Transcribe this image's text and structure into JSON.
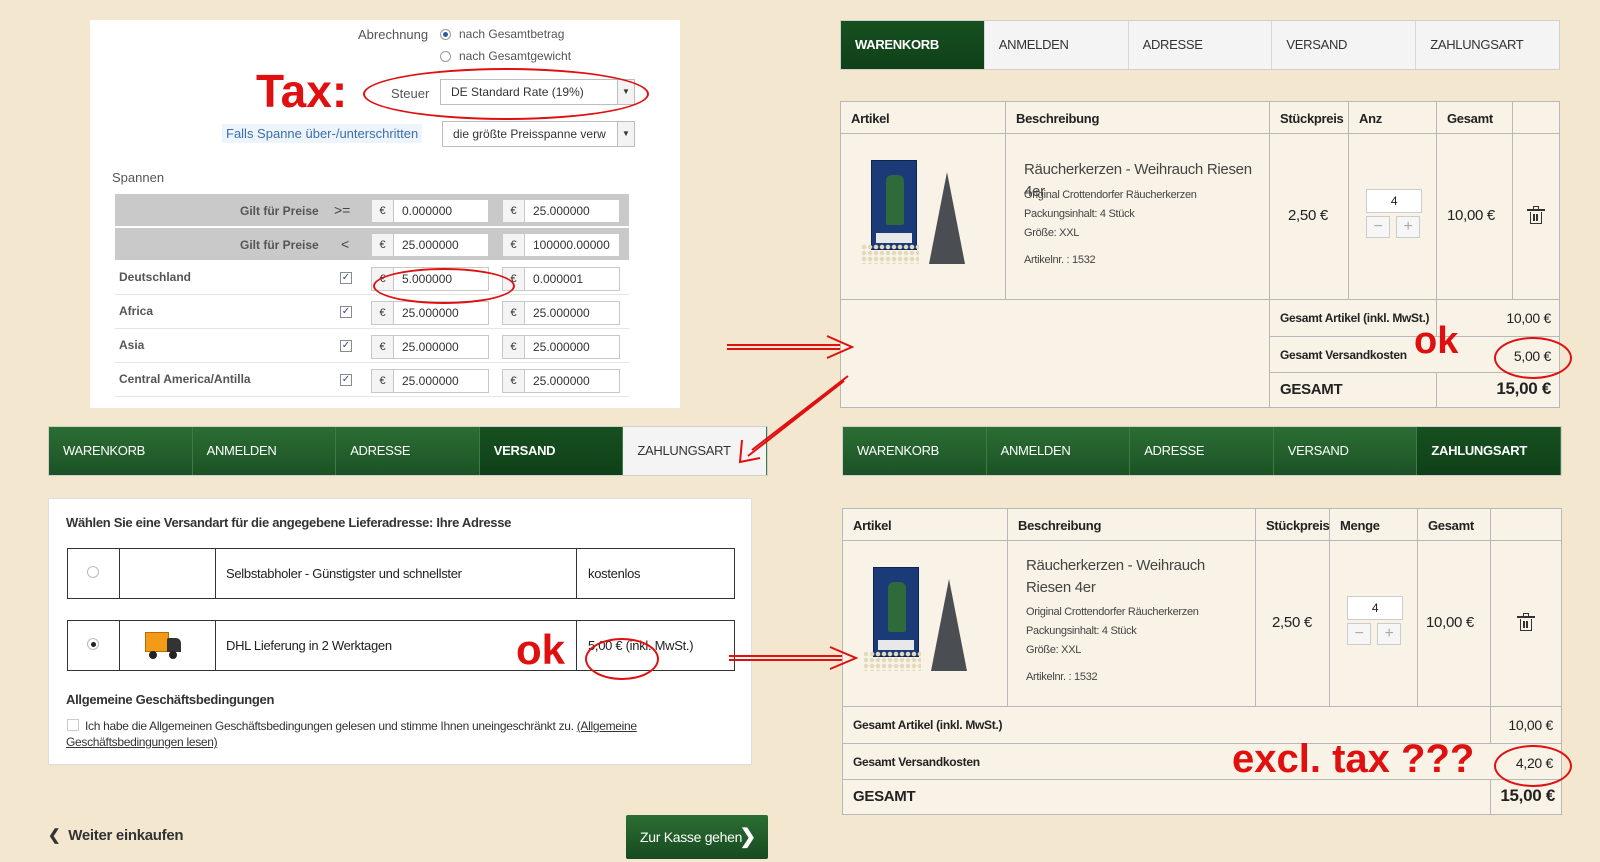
{
  "admin": {
    "abrechnung_label": "Abrechnung",
    "billing_options": [
      "nach Gesamtbetrag",
      "nach Gesamtgewicht"
    ],
    "steuer_label": "Steuer",
    "steuer_value": "DE Standard Rate (19%)",
    "falls_label": "Falls Spanne über-/unterschritten",
    "falls_value": "die größte Preisspanne verw",
    "spannen_label": "Spannen",
    "price_rows": [
      {
        "label": "Gilt für Preise",
        "op": ">=",
        "v1": "0.000000",
        "v2": "25.000000"
      },
      {
        "label": "Gilt für Preise",
        "op": "<",
        "v1": "25.000000",
        "v2": "100000.00000"
      }
    ],
    "region_rows": [
      {
        "label": "Deutschland",
        "v1": "5.000000",
        "v2": "0.000001"
      },
      {
        "label": "Africa",
        "v1": "25.000000",
        "v2": "25.000000"
      },
      {
        "label": "Asia",
        "v1": "25.000000",
        "v2": "25.000000"
      },
      {
        "label": "Central America/Antilla",
        "v1": "25.000000",
        "v2": "25.000000"
      }
    ],
    "currency": "€"
  },
  "steps": [
    "WARENKORB",
    "ANMELDEN",
    "ADRESSE",
    "VERSAND",
    "ZAHLUNGSART"
  ],
  "cart1": {
    "headers": [
      "Artikel",
      "Beschreibung",
      "Stückpreis",
      "Anz",
      "Gesamt"
    ],
    "product_title": "Räucherkerzen - Weihrauch Riesen 4er",
    "product_info": [
      "Original Crottendorfer Räucherkerzen",
      "Packungsinhalt: 4 Stück",
      "Größe: XXL",
      "Artikelnr. : 1532"
    ],
    "unit_price": "2,50 €",
    "qty": "4",
    "total": "10,00 €",
    "sum_label": "Gesamt Artikel (inkl. MwSt.)",
    "sum_value": "10,00 €",
    "ship_label": "Gesamt Versandkosten",
    "ship_value": "5,00 €",
    "grand_label": "GESAMT",
    "grand_value": "15,00 €"
  },
  "cart2": {
    "headers": [
      "Artikel",
      "Beschreibung",
      "Stückpreis",
      "Menge",
      "Gesamt"
    ],
    "product_title": "Räucherkerzen - Weihrauch Riesen 4er",
    "product_info": [
      "Original Crottendorfer Räucherkerzen",
      "Packungsinhalt: 4 Stück",
      "Größe: XXL",
      "Artikelnr. : 1532"
    ],
    "unit_price": "2,50 €",
    "qty": "4",
    "total": "10,00 €",
    "sum_label": "Gesamt Artikel (inkl. MwSt.)",
    "sum_value": "10,00 €",
    "ship_label": "Gesamt Versandkosten",
    "ship_value": "4,20 €",
    "grand_label": "GESAMT",
    "grand_value": "15,00 €"
  },
  "versand": {
    "title": "Wählen Sie eine Versandart für die angegebene Lieferadresse: Ihre Adresse",
    "options": [
      {
        "name": "Selbstabholer - Günstigster und schnellster",
        "price": "kostenlos"
      },
      {
        "name": "DHL Lieferung in 2 Werktagen",
        "price": "5,00 € (inkl. MwSt.)"
      }
    ],
    "agb_title": "Allgemeine Geschäftsbedingungen",
    "agb_text": "Ich habe die Allgemeinen Geschäftsbedingungen gelesen und stimme Ihnen uneingeschränkt zu.",
    "agb_link": "(Allgemeine Geschäftsbedingungen lesen)"
  },
  "nav": {
    "back_label": "Weiter einkaufen",
    "checkout_label": "Zur Kasse gehen"
  },
  "annotations": {
    "tax": "Tax:",
    "ok": "ok",
    "excl": "excl. tax ???"
  },
  "colors": {
    "background": "#f3e8cf",
    "green_dark": "#175020",
    "green": "#2b6e33",
    "annotation_red": "#e01010"
  }
}
